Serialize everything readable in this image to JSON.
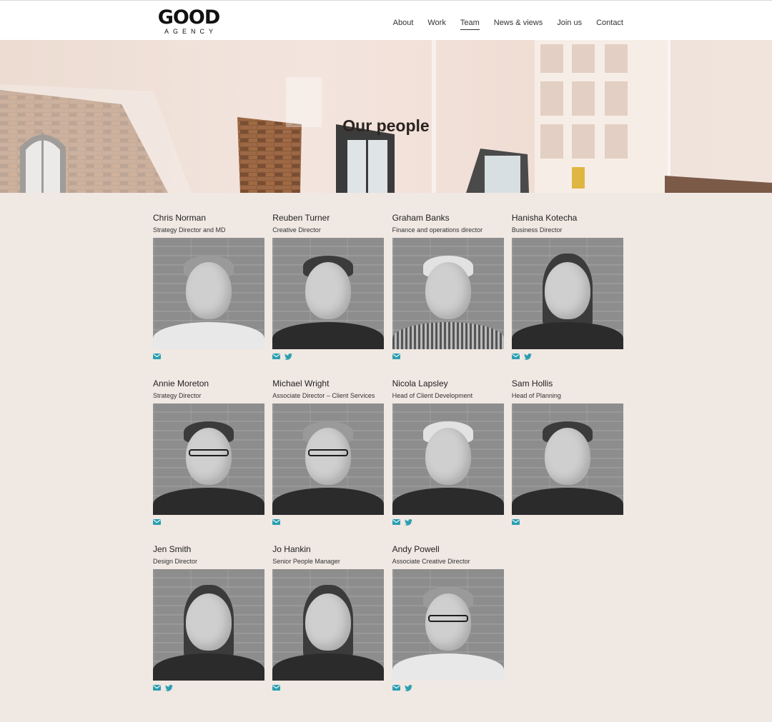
{
  "brand": {
    "name": "GOOD",
    "subtitle": "AGENCY"
  },
  "nav": {
    "items": [
      "About",
      "Work",
      "Team",
      "News & views",
      "Join us",
      "Contact"
    ],
    "active": "Team"
  },
  "hero": {
    "title": "Our people"
  },
  "colors": {
    "accent": "#2a9fb0",
    "background": "#f0e8e3"
  },
  "team": [
    {
      "name": "Chris Norman",
      "role": "Strategy Director and MD",
      "links": [
        "email"
      ]
    },
    {
      "name": "Reuben Turner",
      "role": "Creative Director",
      "links": [
        "email",
        "twitter"
      ]
    },
    {
      "name": "Graham Banks",
      "role": "Finance and operations director",
      "links": [
        "email"
      ]
    },
    {
      "name": "Hanisha Kotecha",
      "role": "Business Director",
      "links": [
        "email",
        "twitter"
      ]
    },
    {
      "name": "Annie Moreton",
      "role": "Strategy Director",
      "links": [
        "email"
      ]
    },
    {
      "name": "Michael Wright",
      "role": "Associate Director – Client Services",
      "links": [
        "email"
      ]
    },
    {
      "name": "Nicola Lapsley",
      "role": "Head of Client Development",
      "links": [
        "email",
        "twitter"
      ]
    },
    {
      "name": "Sam Hollis",
      "role": "Head of Planning",
      "links": [
        "email"
      ]
    },
    {
      "name": "Jen Smith",
      "role": "Design Director",
      "links": [
        "email",
        "twitter"
      ]
    },
    {
      "name": "Jo Hankin",
      "role": "Senior People Manager",
      "links": [
        "email"
      ]
    },
    {
      "name": "Andy Powell",
      "role": "Associate Creative Director",
      "links": [
        "email",
        "twitter"
      ]
    }
  ]
}
